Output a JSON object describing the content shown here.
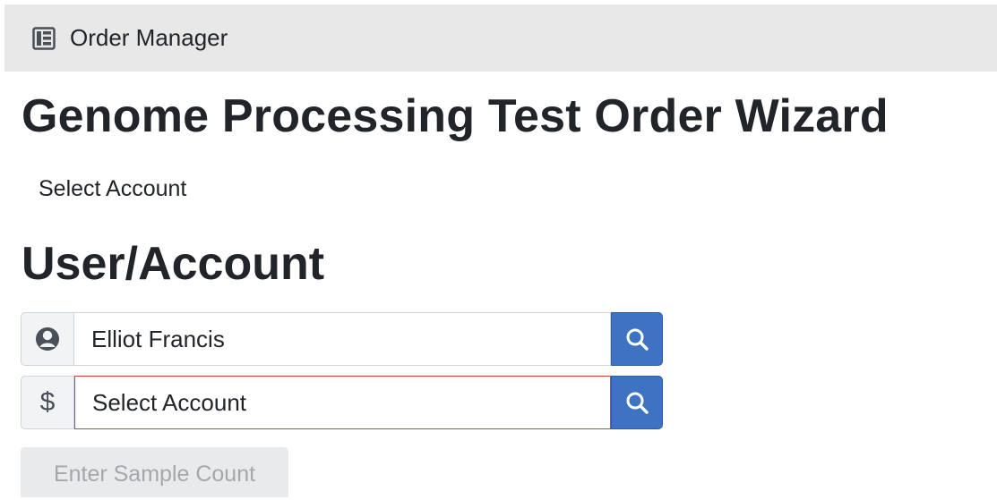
{
  "header": {
    "app_icon": "sidebar-panel-icon",
    "app_title": "Order Manager"
  },
  "page": {
    "title": "Genome Processing Test Order Wizard",
    "step_label": "Select Account",
    "section_title": "User/Account"
  },
  "user_field": {
    "icon": "user-icon",
    "value": "Elliot Francis",
    "search_icon": "search-icon"
  },
  "account_field": {
    "icon": "dollar-icon",
    "icon_text": "$",
    "value": "Select Account",
    "search_icon": "search-icon",
    "state": "invalid"
  },
  "actions": {
    "next_label": "Enter Sample Count",
    "next_disabled": true
  },
  "colors": {
    "topbar_bg": "#e8e8e8",
    "search_button": "#3d73c2",
    "invalid_border": "#dc3545",
    "disabled_button": "#e9eaeb"
  }
}
